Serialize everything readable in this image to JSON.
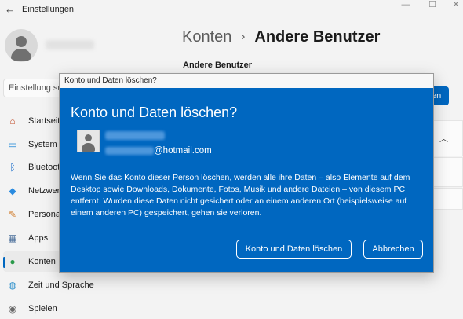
{
  "window": {
    "title": "Einstellungen",
    "back_glyph": "←",
    "minimize_glyph": "—",
    "maximize_glyph": "☐",
    "close_glyph": "✕"
  },
  "search": {
    "placeholder": "Einstellung su"
  },
  "nav": [
    {
      "label": "Startseite",
      "icon": "home-icon",
      "glyph": "⌂"
    },
    {
      "label": "System",
      "icon": "monitor-icon",
      "glyph": "▭"
    },
    {
      "label": "Bluetooth",
      "icon": "bluetooth-icon",
      "glyph": "ᛒ"
    },
    {
      "label": "Netzwerk",
      "icon": "wifi-icon",
      "glyph": "◆"
    },
    {
      "label": "Personal",
      "icon": "brush-icon",
      "glyph": "✎"
    },
    {
      "label": "Apps",
      "icon": "apps-icon",
      "glyph": "▦"
    },
    {
      "label": "Konten",
      "icon": "person-icon",
      "glyph": "●"
    },
    {
      "label": "Zeit und Sprache",
      "icon": "globe-clock-icon",
      "glyph": "◍"
    },
    {
      "label": "Spielen",
      "icon": "gamepad-icon",
      "glyph": "◉"
    }
  ],
  "header": {
    "parent": "Konten",
    "separator": "›",
    "current": "Andere Benutzer"
  },
  "section_label": "Andere Benutzer",
  "background_button_text": "en",
  "dialog": {
    "window_title": "Konto und Daten löschen?",
    "heading": "Konto und Daten löschen?",
    "email_domain": "@hotmail.com",
    "warning": "Wenn Sie das Konto dieser Person löschen, werden alle ihre Daten – also Elemente auf dem Desktop sowie Downloads, Dokumente, Fotos, Musik und andere Dateien – von diesem PC entfernt. Wurden diese Daten nicht gesichert oder an einem anderen Ort (beispielsweise auf einem anderen PC) gespeichert, gehen sie verloren.",
    "delete_button": "Konto und Daten löschen",
    "cancel_button": "Abbrechen"
  },
  "colors": {
    "accent": "#0067c0",
    "background": "#f3f3f3"
  }
}
